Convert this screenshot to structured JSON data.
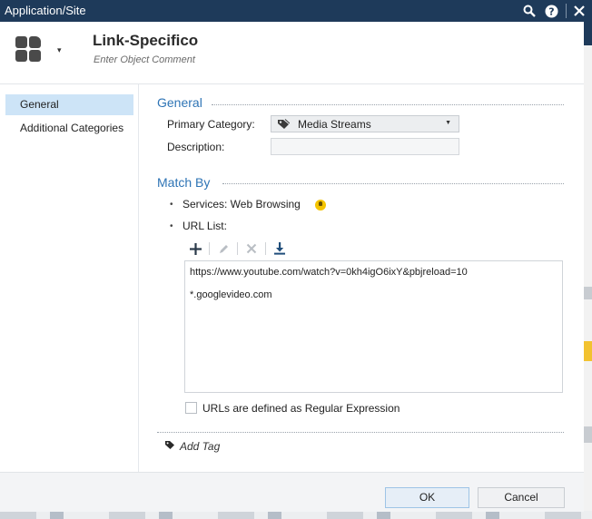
{
  "window": {
    "title": "Application/Site"
  },
  "titlebar_icons": [
    "search-icon",
    "help-icon",
    "close-icon"
  ],
  "header": {
    "object_name": "Link-Specifico",
    "object_comment": "Enter Object Comment"
  },
  "sidebar": {
    "items": [
      {
        "label": "General",
        "active": true
      },
      {
        "label": "Additional Categories",
        "active": false
      }
    ]
  },
  "general": {
    "section_title": "General",
    "primary_category_label": "Primary Category:",
    "primary_category_value": "Media Streams",
    "description_label": "Description:",
    "description_value": ""
  },
  "match_by": {
    "section_title": "Match By",
    "services": "Services: Web Browsing",
    "url_list_label": "URL List:",
    "toolbar_icons": [
      "add-icon",
      "edit-icon",
      "delete-icon",
      "import-icon"
    ],
    "urls": [
      "https://www.youtube.com/watch?v=0kh4igO6ixY&pbjreload=10",
      "*.googlevideo.com"
    ],
    "regex_label": "URLs are defined as Regular Expression",
    "regex_checked": false
  },
  "add_tag": {
    "label": "Add Tag"
  },
  "footer": {
    "ok_label": "OK",
    "cancel_label": "Cancel"
  },
  "colors": {
    "titlebar": "#1e3a5a",
    "accent": "#2e74b5",
    "active_nav": "#cde4f7",
    "tip_bulb": "#f5c400"
  }
}
